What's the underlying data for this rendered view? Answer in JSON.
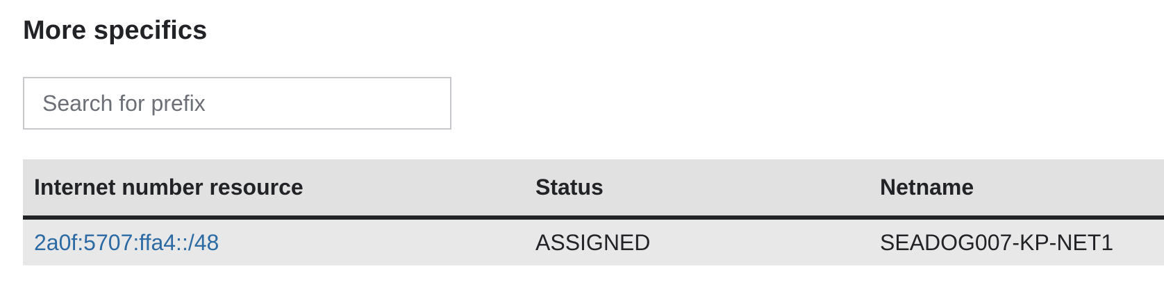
{
  "section": {
    "title": "More specifics"
  },
  "search": {
    "placeholder": "Search for prefix",
    "value": ""
  },
  "table": {
    "headers": {
      "resource": "Internet number resource",
      "status": "Status",
      "netname": "Netname"
    },
    "rows": [
      {
        "resource": "2a0f:5707:ffa4::/48",
        "status": "ASSIGNED",
        "netname": "SEADOG007-KP-NET1"
      }
    ]
  },
  "colors": {
    "link": "#2c6aa3",
    "header_bg": "#e1e1e2",
    "row_bg": "#e8e8e9",
    "header_border": "#222326",
    "input_border": "#c8c8cc"
  }
}
